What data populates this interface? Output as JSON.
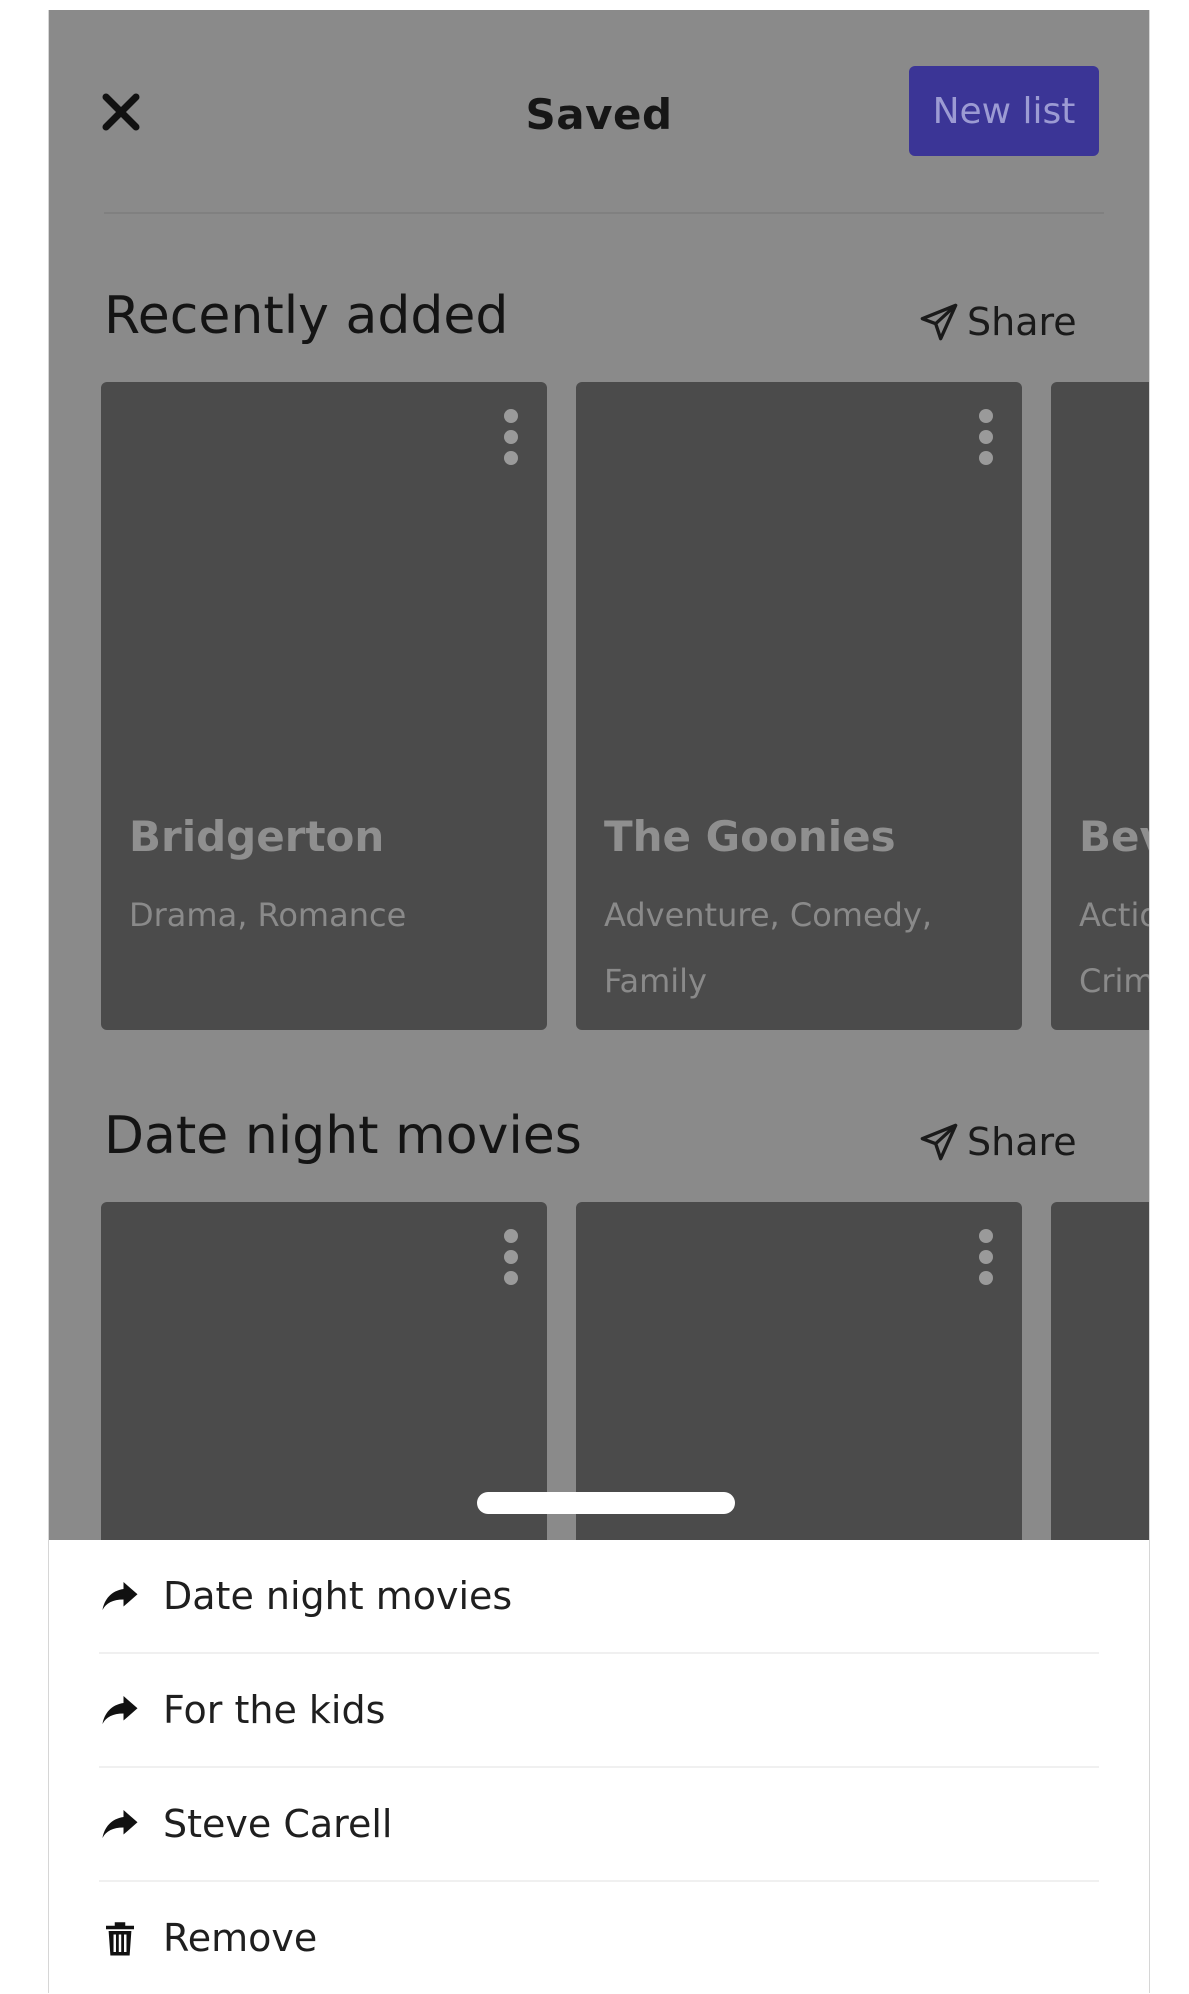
{
  "header": {
    "title": "Saved",
    "new_list_label": "New list",
    "close_icon": "close-icon"
  },
  "sections": [
    {
      "title": "Recently added",
      "share_label": "Share",
      "cards": [
        {
          "title": "Bridgerton",
          "genres": "Drama, Romance"
        },
        {
          "title": "The Goonies",
          "genres": "Adventure, Comedy, Family"
        },
        {
          "title": "Bev",
          "genres": "Actio Crim"
        }
      ]
    },
    {
      "title": "Date night movies",
      "share_label": "Share",
      "cards": [
        {
          "title": "",
          "genres": ""
        },
        {
          "title": "",
          "genres": ""
        },
        {
          "title": "",
          "genres": ""
        }
      ]
    }
  ],
  "sheet": {
    "items": [
      {
        "label": "Date night movies",
        "icon": "share-arrow-icon"
      },
      {
        "label": "For the kids",
        "icon": "share-arrow-icon"
      },
      {
        "label": "Steve Carell",
        "icon": "share-arrow-icon"
      },
      {
        "label": "Remove",
        "icon": "trash-icon"
      }
    ]
  },
  "colors": {
    "overlay_bg": "#8a8a8a",
    "card_bg": "#4b4b4b",
    "accent": "#3b3596",
    "sheet_bg": "#ffffff"
  }
}
